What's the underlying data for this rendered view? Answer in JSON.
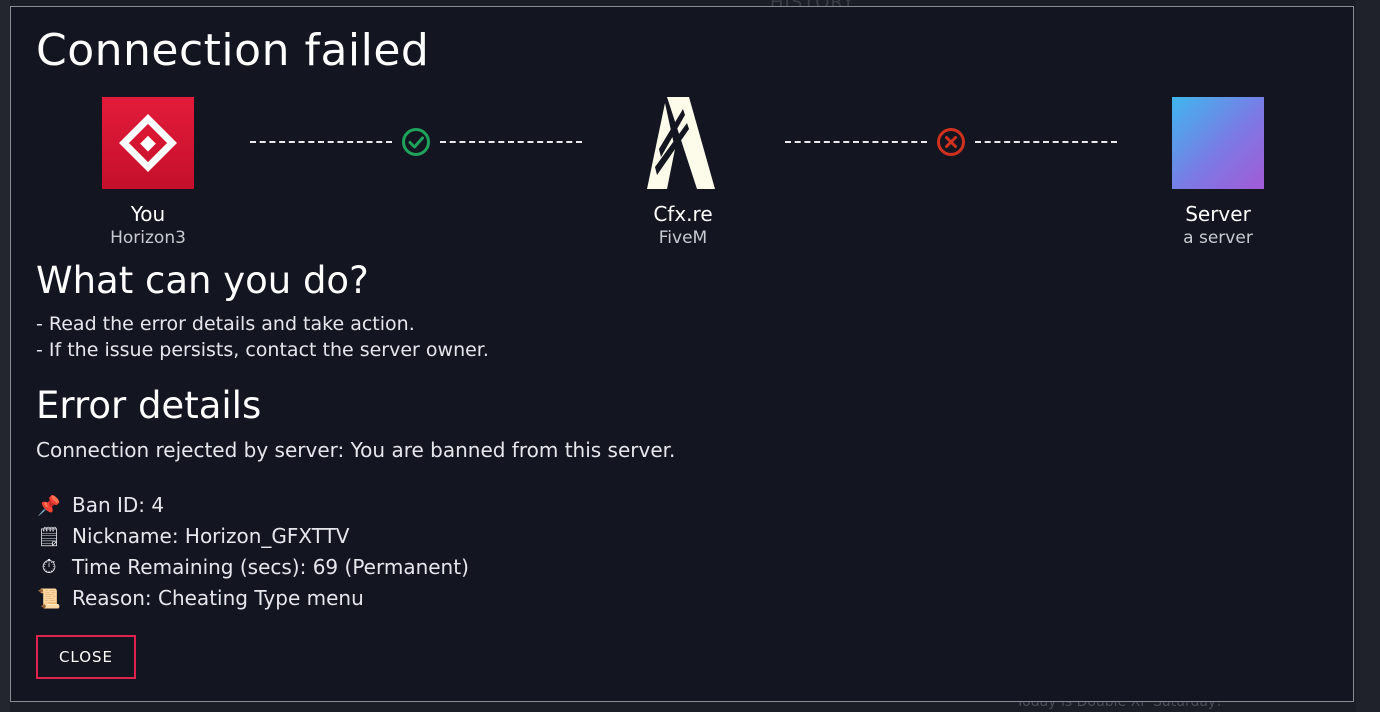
{
  "background": {
    "top_peek_text": "HISTORY",
    "bottom_peek_text": "Today is Double XP Saturday!"
  },
  "dialog": {
    "title": "Connection failed",
    "nodes": {
      "you": {
        "name": "You",
        "sub": "Horizon3",
        "icon": "horizon-logo-icon",
        "color": "#d8142f"
      },
      "cfx": {
        "name": "Cfx.re",
        "sub": "FiveM",
        "icon": "fivem-logo-icon",
        "color": "#fdfbea"
      },
      "server": {
        "name": "Server",
        "sub": "a server",
        "icon": "server-icon"
      }
    },
    "links": {
      "you_to_cfx": {
        "status": "ok",
        "icon": "check-circle-icon",
        "color": "#1ea35a"
      },
      "cfx_to_server": {
        "status": "error",
        "icon": "x-circle-icon",
        "color": "#d0311e"
      }
    },
    "what_can_you_do": {
      "heading": "What can you do?",
      "lines": [
        "- Read the error details and take action.",
        "- If the issue persists, contact the server owner."
      ]
    },
    "error_details": {
      "heading": "Error details",
      "message": "Connection rejected by server: You are banned from this server.",
      "items": [
        {
          "emoji": "📌",
          "icon": "pushpin-icon",
          "text": "Ban ID: 4"
        },
        {
          "emoji": "🗒",
          "icon": "notepad-icon",
          "text": "Nickname: Horizon_GFXTTV"
        },
        {
          "emoji": "⏱",
          "icon": "stopwatch-icon",
          "text": "Time Remaining (secs): 69 (Permanent)"
        },
        {
          "emoji": "📜",
          "icon": "scroll-icon",
          "text": "Reason: Cheating Type menu"
        }
      ]
    },
    "close_label": "CLOSE",
    "accent_color": "#e0234e"
  }
}
